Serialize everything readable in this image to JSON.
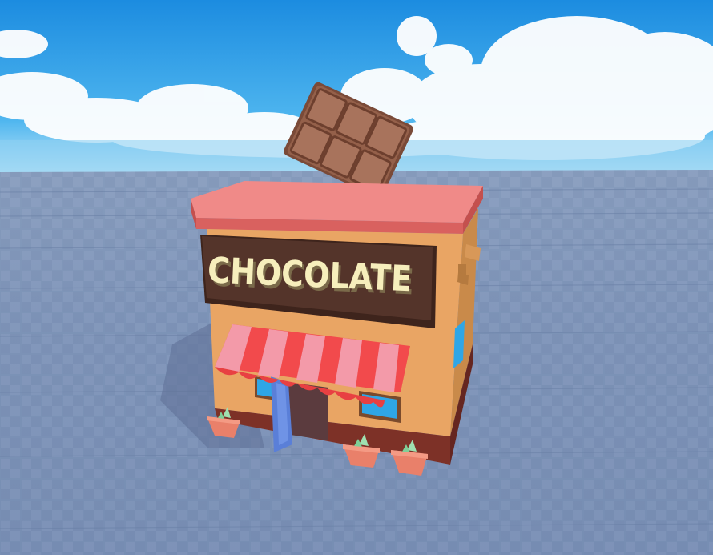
{
  "scene": {
    "building": {
      "sign_text": "CHOCOLATE"
    },
    "colors": {
      "sky_top": "#1e8fe0",
      "sky_horizon": "#bfe4f6",
      "baseplate": "#7f95b8",
      "baseplate_grid": "#6c82a8",
      "roof": "#e77a79",
      "walls": "#e8a35f",
      "wall_shadow": "#c98848",
      "sign_board": "#4c2d23",
      "sign_text": "#f6eebc",
      "awning_red": "#f24a4c",
      "awning_pink": "#f39aa9",
      "door": "#5a7fd8",
      "window_glass": "#2fa6e6",
      "chocolate": "#8e5a45",
      "base_trim": "#8a3a2f",
      "pot": "#e9806a",
      "plant": "#9fe0b0"
    }
  }
}
